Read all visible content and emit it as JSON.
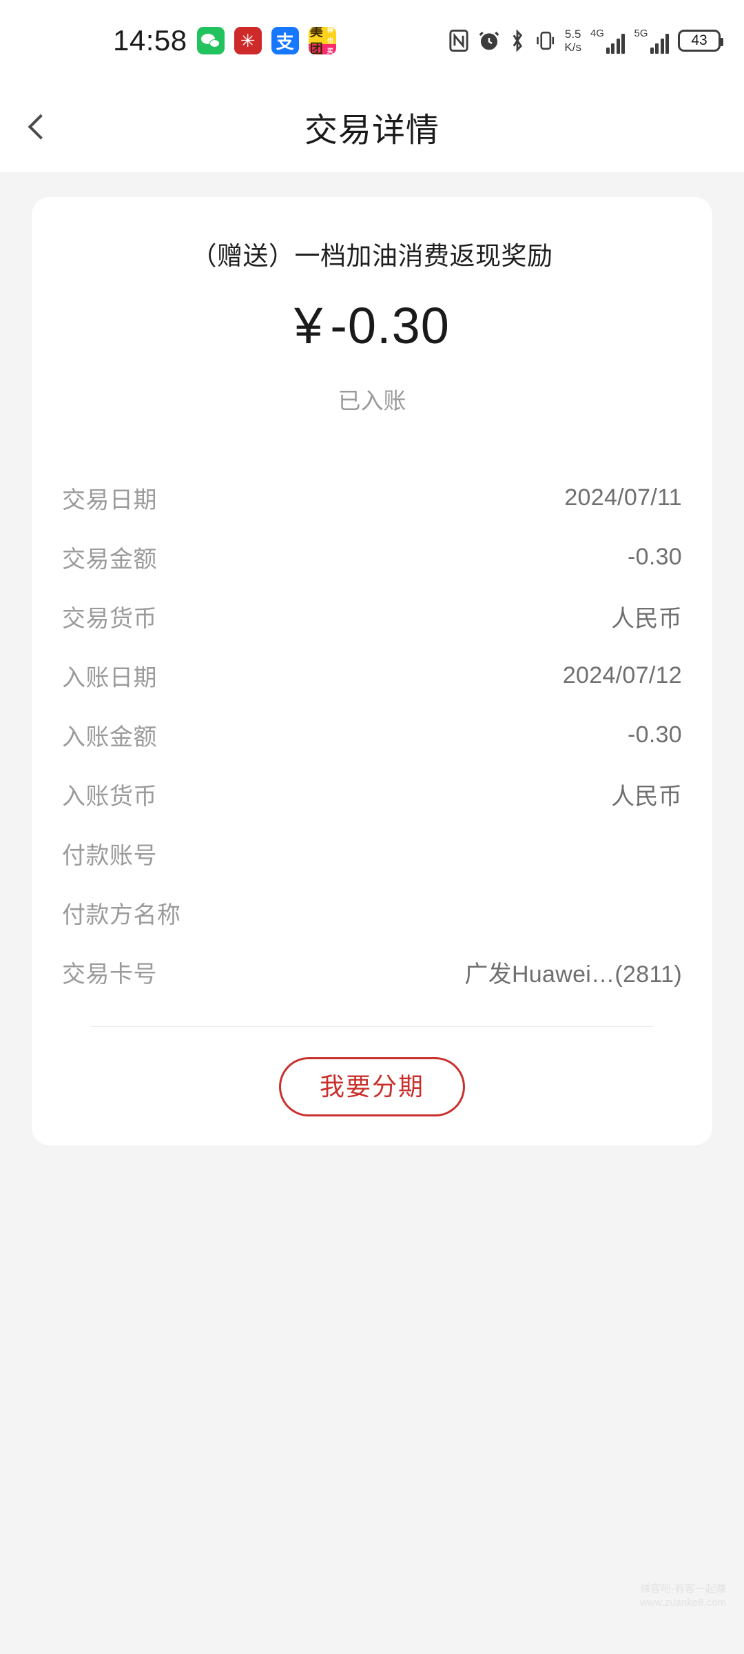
{
  "status_bar": {
    "time": "14:58",
    "app_icons": [
      {
        "name": "wechat-icon",
        "label": ""
      },
      {
        "name": "red-flower-app-icon",
        "label": "✳"
      },
      {
        "name": "alipay-icon",
        "label": "支"
      },
      {
        "name": "meituan-icon",
        "label_top": "美团",
        "label_bottom": "神也买"
      }
    ],
    "network_speed": {
      "value": "5.5",
      "unit": "K/s"
    },
    "signal_1_label": "4G",
    "signal_2_label": "5G",
    "battery_percent": "43"
  },
  "header": {
    "title": "交易详情",
    "back_label": "返回"
  },
  "transaction": {
    "title": "（赠送）一档加油消费返现奖励",
    "currency_symbol": "¥",
    "amount": "-0.30",
    "status": "已入账",
    "details": [
      {
        "label": "交易日期",
        "value": "2024/07/11"
      },
      {
        "label": "交易金额",
        "value": "-0.30"
      },
      {
        "label": "交易货币",
        "value": "人民币"
      },
      {
        "label": "入账日期",
        "value": "2024/07/12"
      },
      {
        "label": "入账金额",
        "value": "-0.30"
      },
      {
        "label": "入账货币",
        "value": "人民币"
      },
      {
        "label": "付款账号",
        "value": ""
      },
      {
        "label": "付款方名称",
        "value": ""
      },
      {
        "label": "交易卡号",
        "value": "广发Huawei…(2811)"
      }
    ],
    "installment_button": "我要分期",
    "accent_color": "#c9302c"
  },
  "watermark": {
    "line1": "赚客吧·有客一起赚",
    "line2": "www.zuanke8.com"
  }
}
